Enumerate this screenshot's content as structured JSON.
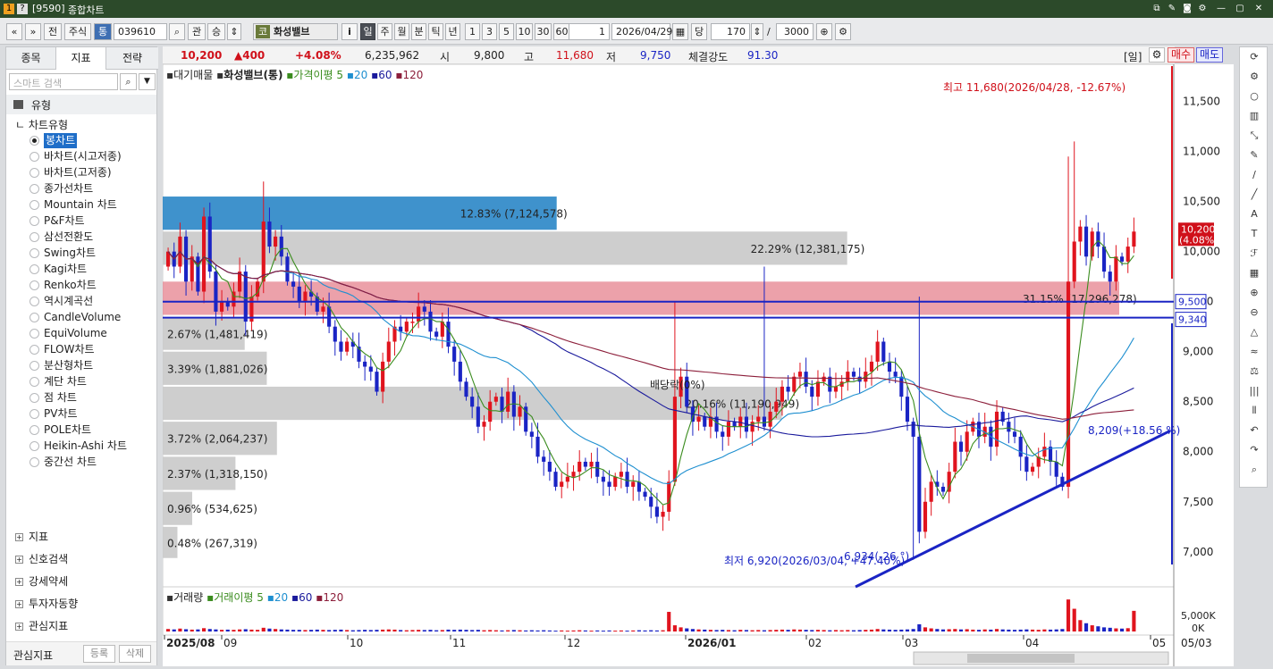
{
  "window": {
    "code": "[9590]",
    "title": "종합차트"
  },
  "toolbar": {
    "btn_prev": "«",
    "btn_down": "»",
    "btn_front": "전",
    "market": "주식",
    "market_tag": "통",
    "code": "039610",
    "kwan": "관",
    "seung": "승",
    "stock_badge": "코",
    "stock_name": "화성밸브",
    "info": "i",
    "periods": [
      "일",
      "주",
      "월",
      "분",
      "틱",
      "년"
    ],
    "period_selected": "일",
    "intervals": [
      "1",
      "3",
      "5",
      "10",
      "30",
      "60"
    ],
    "count1": "1",
    "date": "2026/04/29",
    "dang": "당",
    "count2": "170",
    "slash": "/",
    "count3": "3000"
  },
  "left_panel": {
    "tabs": [
      "종목",
      "지표",
      "전략"
    ],
    "active_tab": "지표",
    "search_placeholder": "스마트 검색",
    "category": "유형",
    "chart_type_header": "차트유형",
    "chart_types": [
      "봉차트",
      "바차트(시고저종)",
      "바차트(고저종)",
      "종가선차트",
      "Mountain 차트",
      "P&F차트",
      "삼선전환도",
      "Swing차트",
      "Kagi차트",
      "Renko차트",
      "역시계곡선",
      "CandleVolume",
      "EquiVolume",
      "FLOW차트",
      "분산형차트",
      "계단 차트",
      "점 차트",
      "PV차트",
      "POLE차트",
      "Heikin-Ashi 차트",
      "중간선 차트"
    ],
    "selected_type": "봉차트",
    "sections": [
      "지표",
      "신호검색",
      "강세약세",
      "투자자동향",
      "관심지표"
    ],
    "bottom_label": "관심지표",
    "btn_register": "등록",
    "btn_delete": "삭제"
  },
  "info_bar": {
    "price": "10,200",
    "change": "▲400",
    "change_pct": "+4.08%",
    "volume": "6,235,962",
    "open_label": "시",
    "open": "9,800",
    "high_label": "고",
    "high": "11,680",
    "low_label": "저",
    "low": "9,750",
    "strength_label": "체결강도",
    "strength": "91.30",
    "period_tag": "[일]",
    "buy": "매수",
    "sell": "매도"
  },
  "chart_data": {
    "type": "candlestick",
    "legend": {
      "vp": "대기매물",
      "name": "화성밸브(통)",
      "ma_label": "가격이평 5",
      "ma": [
        "20",
        "60",
        "120"
      ]
    },
    "vol_legend": {
      "name": "거래량",
      "ma_label": "거래이평 5",
      "ma": [
        "20",
        "60",
        "120"
      ]
    },
    "y_ticks": [
      "11,500",
      "11,000",
      "10,500",
      "10,000",
      "9,500",
      "9,000",
      "8,500",
      "8,000",
      "7,500",
      "7,000"
    ],
    "y_values": [
      11500,
      11000,
      10500,
      10000,
      9500,
      9000,
      8500,
      8000,
      7500,
      7000
    ],
    "vol_ticks": [
      "5,000K",
      "0K"
    ],
    "x_labels": [
      "2025/08",
      "09",
      "10",
      "11",
      "12",
      "2026/01",
      "02",
      "03",
      "04",
      "05"
    ],
    "x_right": "05/03",
    "price_badges": {
      "current": "10,200",
      "current_pct": "(4.08%)",
      "line1": "9,500",
      "line2": "9,340"
    },
    "annotations": {
      "high": "최고 11,680(2026/04/28, -12.67%)",
      "low": "최저 6,920(2026/03/04, +47.40%)",
      "trend1": "8,209(+18.56 %)",
      "trend2": "6,934(-26 °)",
      "divlabel": "배당락(0%)"
    },
    "volume_profile": [
      {
        "label": "12.83% (7,124,578)",
        "pct": 12.83,
        "low": 10200,
        "high": 10550
      },
      {
        "label": "22.29% (12,381,175)",
        "pct": 22.29,
        "low": 9850,
        "high": 10200
      },
      {
        "label": "31.15% (17,296,278)",
        "pct": 31.15,
        "low": 9350,
        "high": 9700
      },
      {
        "label": "2.67% (1,481,419)",
        "pct": 2.67,
        "low": 9000,
        "high": 9340
      },
      {
        "label": "3.39% (1,881,026)",
        "pct": 3.39,
        "low": 8650,
        "high": 9000
      },
      {
        "label": "20.16% (11,190,949)",
        "pct": 20.16,
        "low": 8300,
        "high": 8650
      },
      {
        "label": "3.72% (2,064,237)",
        "pct": 3.72,
        "low": 7950,
        "high": 8300
      },
      {
        "label": "2.37% (1,318,150)",
        "pct": 2.37,
        "low": 7600,
        "high": 7950
      },
      {
        "label": "0.96% (534,625)",
        "pct": 0.96,
        "low": 7250,
        "high": 7600
      },
      {
        "label": "0.48% (267,319)",
        "pct": 0.48,
        "low": 6920,
        "high": 7250
      }
    ],
    "closes": [
      10000,
      9850,
      10150,
      9700,
      9950,
      9600,
      10350,
      9800,
      9400,
      9500,
      9450,
      9600,
      9800,
      9300,
      9550,
      9700,
      10300,
      10050,
      10150,
      9950,
      9700,
      9650,
      9500,
      9600,
      9550,
      9400,
      9450,
      9250,
      9100,
      9000,
      9100,
      9050,
      8900,
      8850,
      8800,
      8600,
      8900,
      9100,
      9250,
      9200,
      9300,
      9300,
      9450,
      9400,
      9200,
      9150,
      9300,
      9050,
      8900,
      8700,
      8550,
      8450,
      8250,
      8300,
      8500,
      8550,
      8400,
      8600,
      8350,
      8450,
      8200,
      8150,
      7950,
      7900,
      7800,
      7650,
      7700,
      7750,
      7800,
      7900,
      7850,
      7900,
      7750,
      7700,
      7650,
      7750,
      7800,
      7650,
      7700,
      7600,
      7550,
      7450,
      7350,
      7400,
      7700,
      8550,
      8750,
      8450,
      8300,
      8350,
      8250,
      8350,
      8200,
      8150,
      8300,
      8250,
      8350,
      8200,
      8300,
      8350,
      8250,
      8400,
      8500,
      8650,
      8600,
      8750,
      8800,
      8650,
      8550,
      8700,
      8750,
      8600,
      8650,
      8700,
      8800,
      8750,
      8700,
      8800,
      8900,
      9100,
      8900,
      8800,
      8750,
      8550,
      8300,
      8150,
      7200,
      7500,
      7700,
      7650,
      7600,
      7800,
      8100,
      8000,
      8200,
      8300,
      8150,
      8250,
      8050,
      8400,
      8300,
      8200,
      8150,
      7950,
      7800,
      7850,
      7950,
      8050,
      7900,
      7750,
      7650,
      9700,
      10100,
      10250,
      9950,
      10200,
      10050,
      9800,
      9700,
      9950,
      9900,
      10050,
      10200
    ],
    "volumes": [
      0.12,
      0.1,
      0.14,
      0.11,
      0.09,
      0.1,
      0.16,
      0.12,
      0.1,
      0.08,
      0.09,
      0.08,
      0.1,
      0.11,
      0.09,
      0.08,
      0.18,
      0.14,
      0.12,
      0.1,
      0.09,
      0.08,
      0.08,
      0.07,
      0.08,
      0.09,
      0.08,
      0.07,
      0.08,
      0.09,
      0.07,
      0.06,
      0.07,
      0.08,
      0.07,
      0.08,
      0.09,
      0.1,
      0.09,
      0.07,
      0.06,
      0.07,
      0.08,
      0.07,
      0.08,
      0.06,
      0.07,
      0.09,
      0.08,
      0.09,
      0.08,
      0.07,
      0.08,
      0.06,
      0.07,
      0.06,
      0.05,
      0.06,
      0.07,
      0.06,
      0.05,
      0.06,
      0.05,
      0.06,
      0.05,
      0.04,
      0.05,
      0.04,
      0.05,
      0.06,
      0.05,
      0.04,
      0.05,
      0.04,
      0.05,
      0.04,
      0.05,
      0.04,
      0.05,
      0.06,
      0.05,
      0.06,
      0.05,
      0.06,
      0.95,
      0.3,
      0.2,
      0.15,
      0.12,
      0.1,
      0.09,
      0.08,
      0.07,
      0.08,
      0.07,
      0.06,
      0.08,
      0.07,
      0.06,
      0.07,
      0.06,
      0.07,
      0.08,
      0.09,
      0.08,
      0.1,
      0.09,
      0.08,
      0.07,
      0.08,
      0.07,
      0.06,
      0.07,
      0.06,
      0.07,
      0.06,
      0.07,
      0.08,
      0.09,
      0.12,
      0.1,
      0.09,
      0.08,
      0.09,
      0.1,
      0.12,
      0.35,
      0.2,
      0.15,
      0.12,
      0.1,
      0.11,
      0.12,
      0.1,
      0.11,
      0.09,
      0.08,
      0.1,
      0.09,
      0.12,
      0.1,
      0.09,
      0.08,
      0.09,
      0.1,
      0.09,
      0.08,
      0.1,
      0.09,
      0.1,
      0.12,
      1.55,
      1.1,
      0.55,
      0.4,
      0.3,
      0.25,
      0.2,
      0.18,
      0.15,
      0.14,
      0.16,
      1.0
    ],
    "colors": {
      "up": "#e0141e",
      "down": "#1a24c4",
      "ma5": "#3a8c1e",
      "ma20": "#1e8fd0",
      "ma60": "#1a1a9c",
      "ma120": "#8c1e3a",
      "vp_blue": "#2a86c6",
      "vp_pink": "#e6828e",
      "vp_gray": "#c9c9c9",
      "trend": "#1a24c4"
    },
    "ylim": [
      6650,
      11800
    ]
  }
}
